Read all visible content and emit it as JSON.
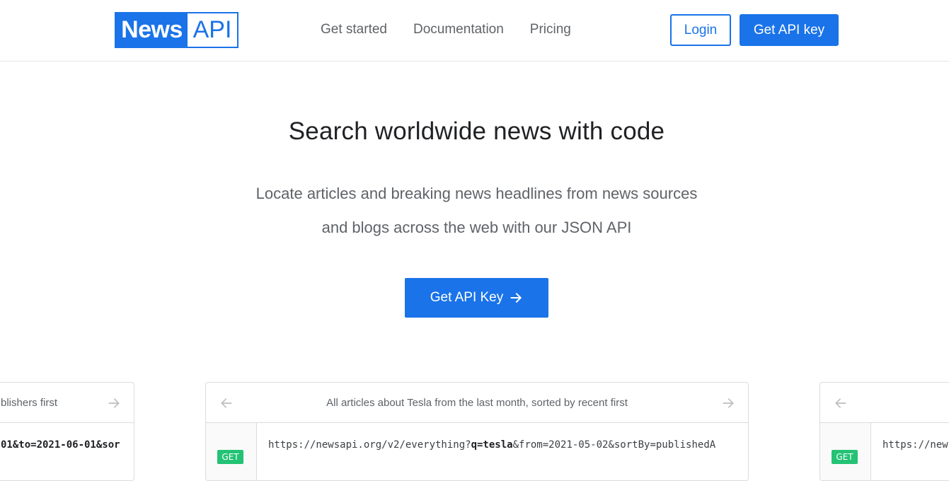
{
  "header": {
    "logo_news": "News",
    "logo_api": "API",
    "nav": [
      "Get started",
      "Documentation",
      "Pricing"
    ],
    "login_label": "Login",
    "get_key_label": "Get API key"
  },
  "hero": {
    "title": "Search worldwide news with code",
    "subtitle": "Locate articles and breaking news headlines from news sources and blogs across the web with our JSON API",
    "cta_label": "Get API Key"
  },
  "cards": {
    "left": {
      "description": "blishers first",
      "url_prefix": "01&to=2021-06-01&sor",
      "url_bold": "",
      "url_suffix": ""
    },
    "center": {
      "description": "All articles about Tesla from the last month, sorted by recent first",
      "method": "GET",
      "url_prefix": "https://newsapi.org/v2/everything?",
      "url_bold": "q=tesla",
      "url_suffix": "&from=2021-05-02&sortBy=publishedA"
    },
    "right": {
      "method": "GET",
      "url_prefix": "https://new"
    }
  },
  "colors": {
    "accent": "#1a73e8",
    "get_badge": "#24c275"
  }
}
